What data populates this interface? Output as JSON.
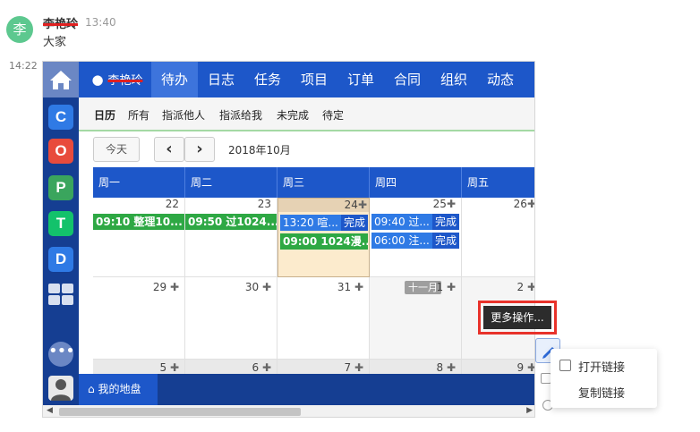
{
  "chat": {
    "avatar_char": "李",
    "sender_name": "李艳玲",
    "message_time": "13:40",
    "message_text": "大家",
    "next_time": "14:22"
  },
  "screenshot": {
    "sidebar_apps": [
      {
        "name": "home",
        "glyph": ""
      },
      {
        "letter": "C",
        "color": "#2f7ae5"
      },
      {
        "letter": "O",
        "color": "#e84b3c"
      },
      {
        "letter": "P",
        "color": "#3aa55d"
      },
      {
        "letter": "T",
        "color": "#13c26b"
      },
      {
        "letter": "D",
        "color": "#2f7ae5"
      }
    ],
    "dots_glyph": "•••",
    "nav": {
      "user": "李艳玲",
      "items": [
        "待办",
        "日志",
        "任务",
        "项目",
        "订单",
        "合同",
        "组织",
        "动态"
      ],
      "active_index": 0
    },
    "subnav": [
      "日历",
      "所有",
      "指派他人",
      "指派给我",
      "未完成",
      "待定"
    ],
    "toolbar": {
      "today": "今天",
      "prev": "‹",
      "next": "›",
      "month": "2018年10月"
    },
    "weekdays": [
      "周一",
      "周二",
      "周三",
      "周四",
      "周五"
    ],
    "week1": {
      "days": [
        "22",
        "23",
        "24",
        "25",
        "26"
      ]
    },
    "week2": {
      "days": [
        "29",
        "30",
        "31",
        "1",
        "2"
      ],
      "nov_badge": "十一月"
    },
    "week3": {
      "days": [
        "5",
        "6",
        "7",
        "8",
        "9"
      ]
    },
    "plus": "✚",
    "events": {
      "mon": "09:10 整理10...",
      "tue": "09:50 过1024...",
      "wed1": "13:20 喧...",
      "wed1_status": "完成",
      "wed2": "09:00 1024漫...",
      "thu1": "09:40 过...",
      "thu1_status": "完成",
      "thu2": "06:00 注...",
      "thu2_status": "完成"
    },
    "bottom_tab": "我的地盘"
  },
  "popups": {
    "more_ops": "更多操作...",
    "menu": {
      "open_link": "打开链接",
      "copy_link": "复制链接"
    }
  }
}
